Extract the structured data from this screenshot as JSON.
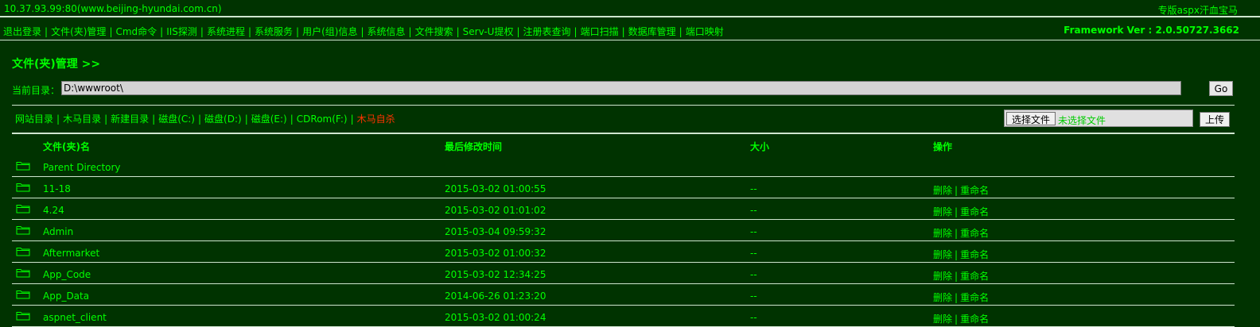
{
  "topbar": {
    "host": "10.37.93.99:80(www.beijing-hyundai.com.cn)",
    "brand": "专版aspx汗血宝马"
  },
  "nav": {
    "items": [
      "退出登录",
      "文件(夹)管理",
      "Cmd命令",
      "IIS探测",
      "系统进程",
      "系统服务",
      "用户(组)信息",
      "系统信息",
      "文件搜索",
      "Serv-U提权",
      "注册表查询",
      "端口扫描",
      "数据库管理",
      "端口映射"
    ],
    "framework": "Framework Ver : 2.0.50727.3662"
  },
  "section": {
    "title": "文件(夹)管理 >>"
  },
  "curdir": {
    "label": "当前目录：",
    "value": "D:\\wwwroot\\",
    "go_label": "Go"
  },
  "quicklinks": {
    "items": [
      "网站目录",
      "木马目录",
      "新建目录",
      "磁盘(C:)",
      "磁盘(D:)",
      "磁盘(E:)",
      "CDRom(F:)"
    ],
    "danger": "木马自杀"
  },
  "upload": {
    "choose_label": "选择文件",
    "no_file": "未选择文件",
    "upload_label": "上传"
  },
  "table": {
    "headers": {
      "name": "文件(夹)名",
      "modified": "最后修改时间",
      "size": "大小",
      "ops": "操作"
    },
    "parent": "Parent Directory",
    "rows": [
      {
        "name": "11-18",
        "modified": "2015-03-02 01:00:55",
        "size": "--",
        "delete": "删除",
        "rename": "重命名"
      },
      {
        "name": "4.24",
        "modified": "2015-03-02 01:01:02",
        "size": "--",
        "delete": "删除",
        "rename": "重命名"
      },
      {
        "name": "Admin",
        "modified": "2015-03-04 09:59:32",
        "size": "--",
        "delete": "删除",
        "rename": "重命名"
      },
      {
        "name": "Aftermarket",
        "modified": "2015-03-02 01:00:32",
        "size": "--",
        "delete": "删除",
        "rename": "重命名"
      },
      {
        "name": "App_Code",
        "modified": "2015-03-02 12:34:25",
        "size": "--",
        "delete": "删除",
        "rename": "重命名"
      },
      {
        "name": "App_Data",
        "modified": "2014-06-26 01:23:20",
        "size": "--",
        "delete": "删除",
        "rename": "重命名"
      },
      {
        "name": "aspnet_client",
        "modified": "2015-03-02 01:00:24",
        "size": "--",
        "delete": "删除",
        "rename": "重命名"
      }
    ]
  },
  "colors": {
    "background": "#003300",
    "text": "#00ff00",
    "danger": "#ff3300",
    "rule": "#cfe6cf"
  },
  "icons": {
    "folder": "folder-icon"
  }
}
